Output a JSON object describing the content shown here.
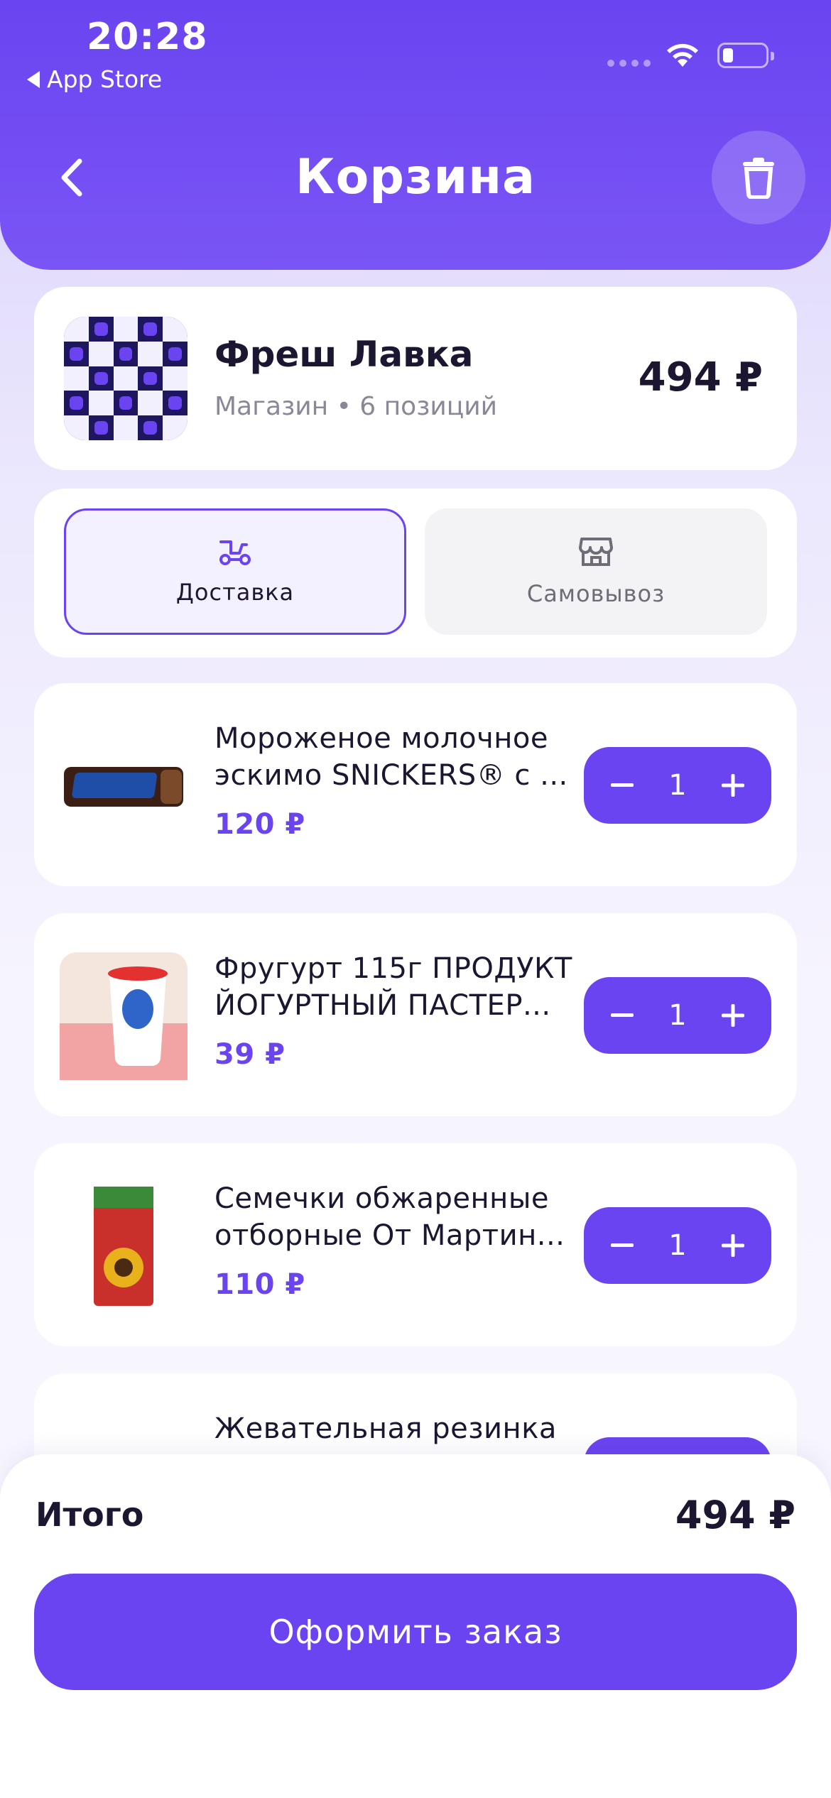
{
  "status_bar": {
    "time": "20:28",
    "back_app": "App Store"
  },
  "header": {
    "title": "Корзина"
  },
  "store": {
    "name": "Фреш Лавка",
    "subtitle": "Магазин • 6 позиций",
    "total": "494 ₽"
  },
  "modes": [
    {
      "label": "Доставка",
      "selected": true,
      "icon": "scooter-icon"
    },
    {
      "label": "Самовывоз",
      "selected": false,
      "icon": "store-icon"
    }
  ],
  "items": [
    {
      "name_line1": "Мороженое молочное",
      "name_line2": "эскимо SNICKERS® с ...",
      "price": "120 ₽",
      "qty": "1"
    },
    {
      "name_line1": "Фругурт 115г ПРОДУКТ",
      "name_line2": "ЙОГУРТНЫЙ ПАСТЕР...",
      "price": "39 ₽",
      "qty": "1"
    },
    {
      "name_line1": "Семечки обжаренные",
      "name_line2": "отборные От Мартин...",
      "price": "110 ₽",
      "qty": "1"
    },
    {
      "name_line1": "Жевательная резинка"
    }
  ],
  "footer": {
    "total_label": "Итого",
    "total_value": "494 ₽",
    "checkout_label": "Оформить заказ"
  },
  "colors": {
    "accent": "#6a44f0",
    "text": "#1c1630",
    "muted": "#8a8797"
  }
}
